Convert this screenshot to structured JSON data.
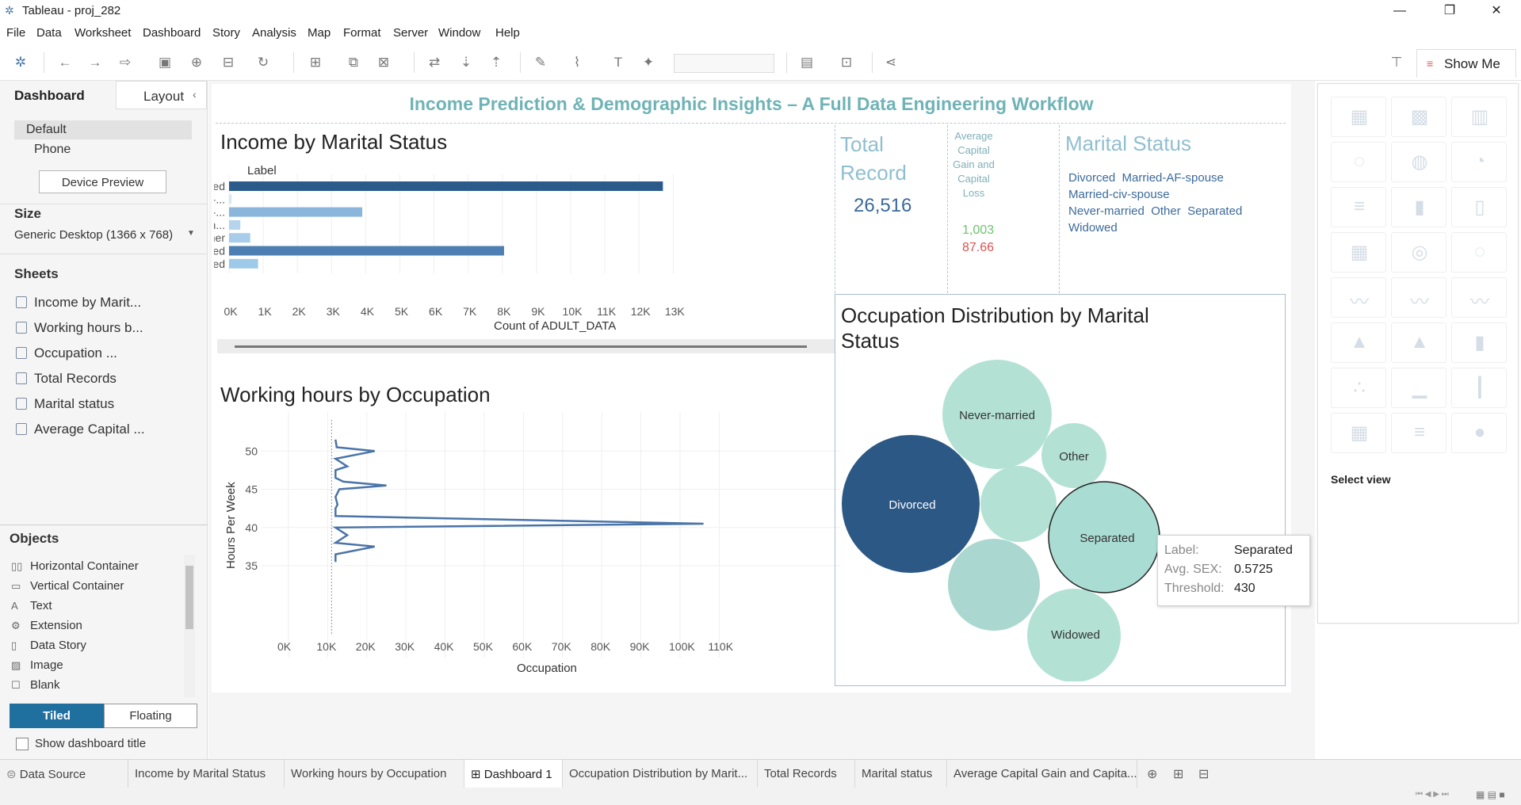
{
  "window": {
    "title": "Tableau - proj_282"
  },
  "menu": [
    "File",
    "Data",
    "Worksheet",
    "Dashboard",
    "Story",
    "Analysis",
    "Map",
    "Format",
    "Server",
    "Window",
    "Help"
  ],
  "toolbar": {
    "show_me": "Show Me"
  },
  "left_panel": {
    "tabs": [
      "Dashboard",
      "Layout"
    ],
    "device_options": [
      "Default",
      "Phone"
    ],
    "device_preview_button": "Device Preview",
    "size_header": "Size",
    "size_value": "Generic Desktop (1366 x 768)",
    "sheets_header": "Sheets",
    "sheets": [
      "Income by Marit...",
      "Working hours b...",
      "Occupation ...",
      "Total Records",
      "Marital status",
      "Average Capital ..."
    ],
    "objects_header": "Objects",
    "objects": [
      "Horizontal Container",
      "Vertical Container",
      "Text",
      "Extension",
      "Data Story",
      "Image",
      "Blank"
    ],
    "tiled": "Tiled",
    "floating": "Floating",
    "show_title": "Show dashboard title"
  },
  "dashboard": {
    "title": "Income Prediction & Demographic Insights – A Full Data Engineering Workflow",
    "income_chart": {
      "title": "Income by Marital Status",
      "label_header": "Label",
      "xlabel": "Count of ADULT_DATA",
      "ticks": [
        "0K",
        "1K",
        "2K",
        "3K",
        "4K",
        "5K",
        "6K",
        "7K",
        "8K",
        "9K",
        "10K",
        "11K",
        "12K",
        "13K"
      ]
    },
    "hours_chart": {
      "title": "Working hours by Occupation",
      "xlabel": "Occupation",
      "ylabel": "Hours Per Week",
      "xticks": [
        "0K",
        "10K",
        "20K",
        "30K",
        "40K",
        "50K",
        "60K",
        "70K",
        "80K",
        "90K",
        "100K",
        "110K"
      ],
      "yticks": [
        "50",
        "45",
        "40",
        "35"
      ]
    },
    "total_record": {
      "title": "Total Record",
      "value": "26,516"
    },
    "avg_capital": {
      "title": "Average Capital Gain and Capital Loss",
      "gain": "1,003",
      "loss": "87.66"
    },
    "marital_status": {
      "title": "Marital Status",
      "legend": [
        "Divorced",
        "Married-AF-spouse",
        "Married-civ-spouse",
        "Never-married",
        "Other",
        "Separated",
        "Widowed"
      ]
    },
    "occupation_bubble": {
      "title": "Occupation Distribution by Marital Status",
      "bubbles": [
        "Never-married",
        "Other",
        "Divorced",
        "Separated",
        "Widowed"
      ]
    },
    "tooltip": {
      "label_key": "Label:",
      "label_val": "Separated",
      "sex_key": "Avg. SEX:",
      "sex_val": "0.5725",
      "thr_key": "Threshold:",
      "thr_val": "430"
    }
  },
  "show_me_panel": {
    "select_view": "Select view"
  },
  "tabs": [
    "Data Source",
    "Income by Marital Status",
    "Working hours by Occupation",
    "Dashboard 1",
    "Occupation Distribution by Marit...",
    "Total Records",
    "Marital status",
    "Average Capital Gain and Capita..."
  ],
  "chart_data": [
    {
      "type": "bar",
      "title": "Income by Marital Status",
      "categories": [
        "Divorced",
        "Married-...",
        "Married-...",
        "Never-m...",
        "Other",
        "Separated",
        "Widowed"
      ],
      "values": [
        12700,
        70,
        3900,
        330,
        620,
        8050,
        850
      ],
      "colors": [
        "#2b5b8a",
        "#d6e6f4",
        "#8ab6dc",
        "#b6d4ee",
        "#a8cdeb",
        "#4e7fb3",
        "#9ecae9"
      ],
      "xlabel": "Count of ADULT_DATA",
      "xlim": [
        0,
        13000
      ]
    },
    {
      "type": "line",
      "title": "Working hours by Occupation",
      "xlabel": "Occupation",
      "ylabel": "Hours Per Week",
      "xlim": [
        0,
        112000
      ],
      "ylim": [
        33,
        52
      ],
      "points": [
        [
          12000,
          51.5
        ],
        [
          12300,
          50.5
        ],
        [
          22000,
          50.0
        ],
        [
          12000,
          49.0
        ],
        [
          15000,
          48.0
        ],
        [
          12000,
          47.5
        ],
        [
          12000,
          46.5
        ],
        [
          14000,
          46.0
        ],
        [
          25000,
          45.5
        ],
        [
          13000,
          45.0
        ],
        [
          12000,
          44.0
        ],
        [
          12500,
          43.0
        ],
        [
          12000,
          42.5
        ],
        [
          12000,
          41.5
        ],
        [
          106000,
          40.5
        ],
        [
          12000,
          40.0
        ],
        [
          15000,
          39.0
        ],
        [
          12000,
          38.0
        ],
        [
          22000,
          37.5
        ],
        [
          12000,
          36.5
        ],
        [
          12000,
          35.5
        ]
      ]
    }
  ]
}
